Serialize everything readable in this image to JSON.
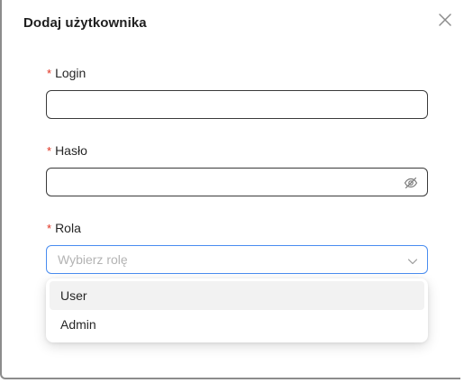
{
  "modal": {
    "title": "Dodaj użytkownika"
  },
  "form": {
    "required_mark": "*",
    "login": {
      "label": "Login",
      "value": ""
    },
    "password": {
      "label": "Hasło",
      "value": ""
    },
    "role": {
      "label": "Rola",
      "placeholder": "Wybierz rolę"
    }
  },
  "dropdown": {
    "options": [
      "User",
      "Admin"
    ],
    "highlighted": "User"
  },
  "icons": {
    "close": "close-icon",
    "password_toggle": "eye-off-icon",
    "select_arrow": "chevron-down-icon"
  },
  "colors": {
    "required": "#e0301e",
    "focus_border": "#4a8df0",
    "highlight": "#f2f2f2"
  }
}
